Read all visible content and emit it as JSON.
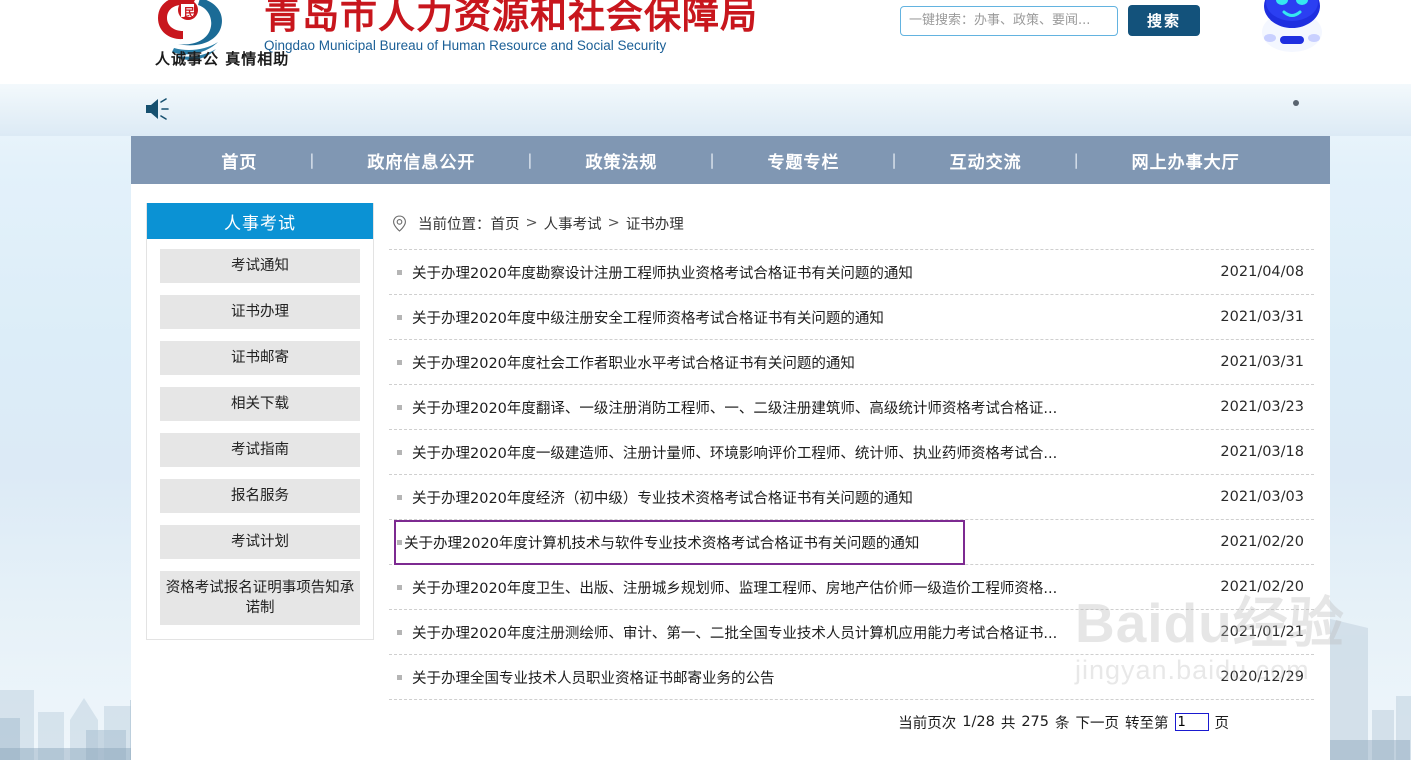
{
  "header": {
    "org_name_cn": "青岛市人力资源和社会保障局",
    "org_name_en": "Qingdao Municipal Bureau of Human Resource and Social Security",
    "slogan": "人诚事公 真情相助",
    "logo_icon": "qingdao-hrss-logo",
    "robot_icon": "chatbot-robot-icon",
    "search": {
      "placeholder": "一键搜索：办事、政策、要闻...",
      "value": "",
      "button_label": "搜索"
    }
  },
  "notice": {
    "speaker_icon": "speaker-announcement-icon",
    "text": ""
  },
  "nav": {
    "separator": "|",
    "items": [
      {
        "label": "首页"
      },
      {
        "label": "政府信息公开"
      },
      {
        "label": "政策法规"
      },
      {
        "label": "专题专栏"
      },
      {
        "label": "互动交流"
      },
      {
        "label": "网上办事大厅"
      }
    ]
  },
  "sidebar": {
    "title": "人事考试",
    "items": [
      {
        "label": "考试通知"
      },
      {
        "label": "证书办理"
      },
      {
        "label": "证书邮寄"
      },
      {
        "label": "相关下载"
      },
      {
        "label": "考试指南"
      },
      {
        "label": "报名服务"
      },
      {
        "label": "考试计划"
      },
      {
        "label": "资格考试报名证明事项告知承诺制"
      }
    ]
  },
  "breadcrumb": {
    "pin_icon": "location-pin-icon",
    "prefix": "当前位置：",
    "separator": ">",
    "items": [
      {
        "label": "首页"
      },
      {
        "label": "人事考试"
      },
      {
        "label": "证书办理"
      }
    ]
  },
  "list": {
    "rows": [
      {
        "title": "关于办理2020年度勘察设计注册工程师执业资格考试合格证书有关问题的通知",
        "date": "2021/04/08",
        "highlighted": false
      },
      {
        "title": "关于办理2020年度中级注册安全工程师资格考试合格证书有关问题的通知",
        "date": "2021/03/31",
        "highlighted": false
      },
      {
        "title": "关于办理2020年度社会工作者职业水平考试合格证书有关问题的通知",
        "date": "2021/03/31",
        "highlighted": false
      },
      {
        "title": "关于办理2020年度翻译、一级注册消防工程师、一、二级注册建筑师、高级统计师资格考试合格证...",
        "date": "2021/03/23",
        "highlighted": false
      },
      {
        "title": "关于办理2020年度一级建造师、注册计量师、环境影响评价工程师、统计师、执业药师资格考试合...",
        "date": "2021/03/18",
        "highlighted": false
      },
      {
        "title": "关于办理2020年度经济（初中级）专业技术资格考试合格证书有关问题的通知",
        "date": "2021/03/03",
        "highlighted": false
      },
      {
        "title": "关于办理2020年度计算机技术与软件专业技术资格考试合格证书有关问题的通知",
        "date": "2021/02/20",
        "highlighted": true
      },
      {
        "title": "关于办理2020年度卫生、出版、注册城乡规划师、监理工程师、房地产估价师一级造价工程师资格...",
        "date": "2021/02/20",
        "highlighted": false
      },
      {
        "title": "关于办理2020年度注册测绘师、审计、第一、二批全国专业技术人员计算机应用能力考试合格证书...",
        "date": "2021/01/21",
        "highlighted": false
      },
      {
        "title": "关于办理全国专业技术人员职业资格证书邮寄业务的公告",
        "date": "2020/12/29",
        "highlighted": false
      }
    ]
  },
  "pager": {
    "current_label": "当前页次",
    "current_value": "1/28",
    "total_label": "共",
    "total_value": "275",
    "total_unit": "条",
    "next_label": "下一页",
    "goto_label": "转至第",
    "goto_value": "1",
    "goto_unit": "页"
  },
  "watermark": {
    "main": "Baidu经验",
    "sub": "jingyan.baidu.com"
  },
  "colors": {
    "brand_red": "#c8161d",
    "brand_blue": "#1b5f96",
    "nav_bg": "#8097b3",
    "sidebar_head": "#0b92d4",
    "search_btn": "#13527b",
    "highlight_border": "#7d2a91"
  }
}
